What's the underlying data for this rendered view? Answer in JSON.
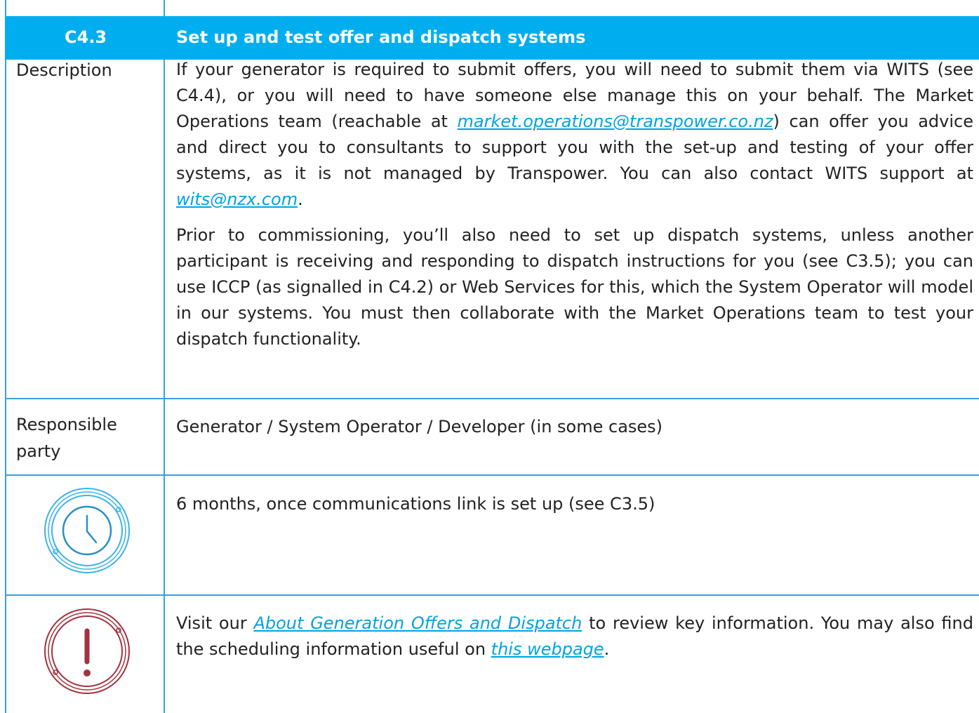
{
  "header": {
    "code": "C4.3",
    "title": "Set up and test offer and dispatch systems"
  },
  "description": {
    "label": "Description",
    "p1_a": "If your generator is required to submit offers, you will need to submit them via WITS (see C4.4), or you will need to have someone else manage this on your behalf. The Market Operations team (reachable at ",
    "p1_link": "market.operations@transpower.co.nz",
    "p1_b": ") can offer you advice and direct you to consultants to support you with the set-up and testing of your offer systems, as it is not managed by Transpower. You can also contact WITS support at ",
    "p1_link2": "wits@nzx.com",
    "p1_c": ".",
    "p2": "Prior to commissioning, you’ll also need to set up dispatch systems, unless another participant is receiving and responding to dispatch instructions for you (see C3.5); you can use ICCP (as signalled in C4.2) or Web Services for this, which the System Operator will model in our systems. You must then collaborate with the Market Operations team to test your dispatch functionality."
  },
  "responsible": {
    "label_line1": "Responsible",
    "label_line2": "party",
    "text": "Generator / System Operator / Developer (in some cases)"
  },
  "timing": {
    "icon": "clock-icon",
    "text": "6 months, once communications link is set up (see C3.5)"
  },
  "info": {
    "icon": "exclamation-icon",
    "text_a": "Visit our ",
    "link1": "About Generation Offers and Dispatch",
    "text_b": " to review key information. You may also find the scheduling information useful on ",
    "link2": "this webpage",
    "text_c": "."
  },
  "colors": {
    "header_bg": "#00aeef",
    "border": "#3f9fd3",
    "link": "#00a3e0",
    "clock_icon": "#3bb4e5",
    "alert_icon": "#a3313f"
  }
}
